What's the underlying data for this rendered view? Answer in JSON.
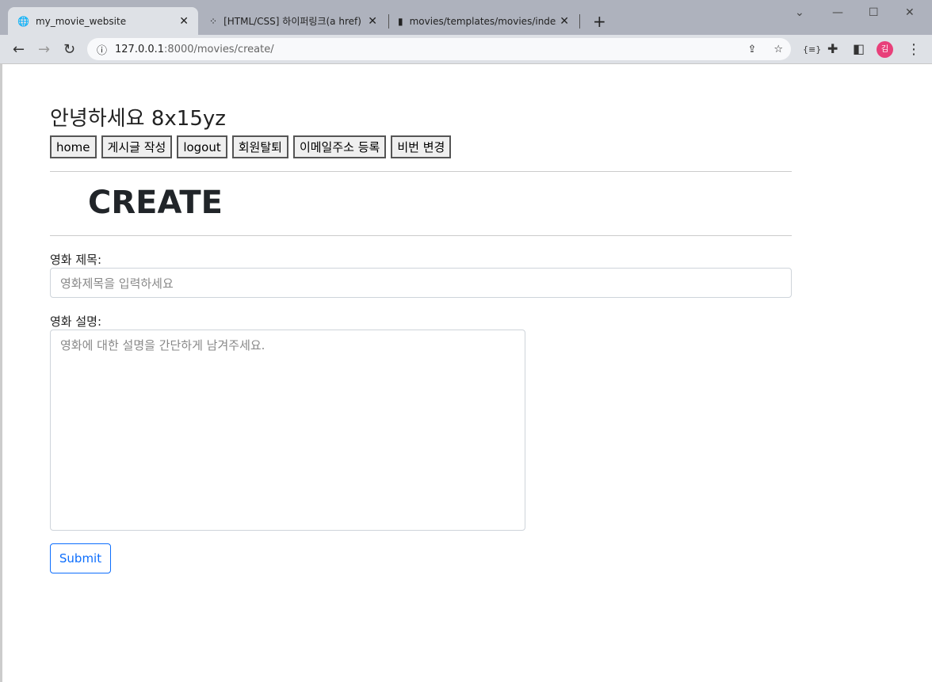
{
  "browser": {
    "tabs": [
      {
        "title": "my_movie_website",
        "icon": "globe-icon"
      },
      {
        "title": "[HTML/CSS] 하이퍼링크(a href)",
        "icon": "tistory-icon"
      },
      {
        "title": "movies/templates/movies/index",
        "icon": "file-icon"
      }
    ],
    "url_host": "127.0.0.1",
    "url_path": ":8000/movies/create/",
    "profile_initial": "김"
  },
  "page": {
    "greeting": "안녕하세요 8x15yz",
    "nav_buttons": [
      "home",
      "게시글 작성",
      "logout",
      "회원탈퇴",
      "이메일주소 등록",
      "비번 변경"
    ],
    "heading": "CREATE",
    "title_label": "영화 제목:",
    "title_placeholder": "영화제목을 입력하세요",
    "desc_label": "영화 설명:",
    "desc_placeholder": "영화에 대한 설명을 간단하게 남겨주세요.",
    "submit_label": "Submit",
    "accent": "#0d6efd"
  }
}
